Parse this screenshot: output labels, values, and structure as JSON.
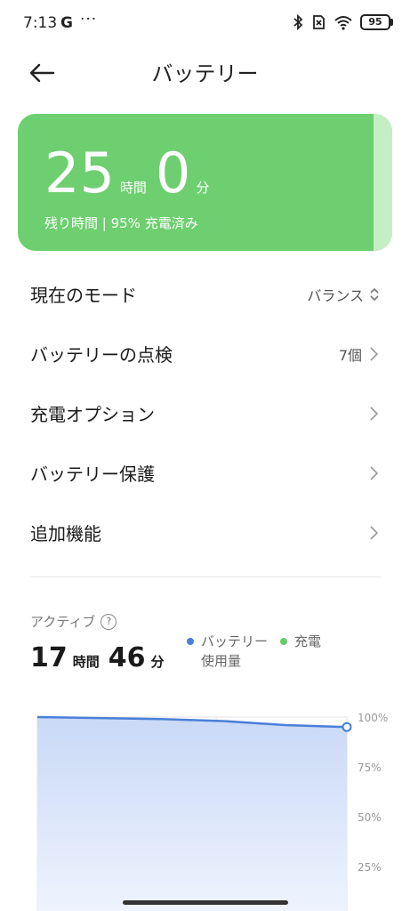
{
  "status": {
    "time": "7:13",
    "g": "G",
    "dots": "···",
    "battery": "95"
  },
  "header": {
    "title": "バッテリー"
  },
  "battery_card": {
    "hours": "25",
    "hours_unit": "時間",
    "minutes": "0",
    "minutes_unit": "分",
    "subtitle": "残り時間 | 95% 充電済み",
    "level_percent": 95
  },
  "menu": {
    "items": [
      {
        "label": "現在のモード",
        "value": "バランス"
      },
      {
        "label": "バッテリーの点検",
        "value": "7個"
      },
      {
        "label": "充電オプション",
        "value": ""
      },
      {
        "label": "バッテリー保護",
        "value": ""
      },
      {
        "label": "追加機能",
        "value": ""
      }
    ]
  },
  "active": {
    "label": "アクティブ",
    "hours": "17",
    "hours_unit": "時間",
    "minutes": "46",
    "minutes_unit": "分"
  },
  "legend": {
    "usage_line1": "バッテリー",
    "usage_line2": "使用量",
    "charge": "充電"
  },
  "colors": {
    "card_green": "#6dcf6f",
    "usage_blue": "#4a7fd8",
    "charge_green": "#67c96a"
  },
  "chart_data": {
    "type": "area",
    "y_tick_labels": [
      "100%",
      "75%",
      "50%",
      "25%"
    ],
    "ylim": [
      0,
      100
    ],
    "x": [
      0,
      0.4,
      0.6,
      0.8,
      1.0
    ],
    "values": [
      100,
      99,
      98,
      96,
      95
    ],
    "grid": true
  }
}
